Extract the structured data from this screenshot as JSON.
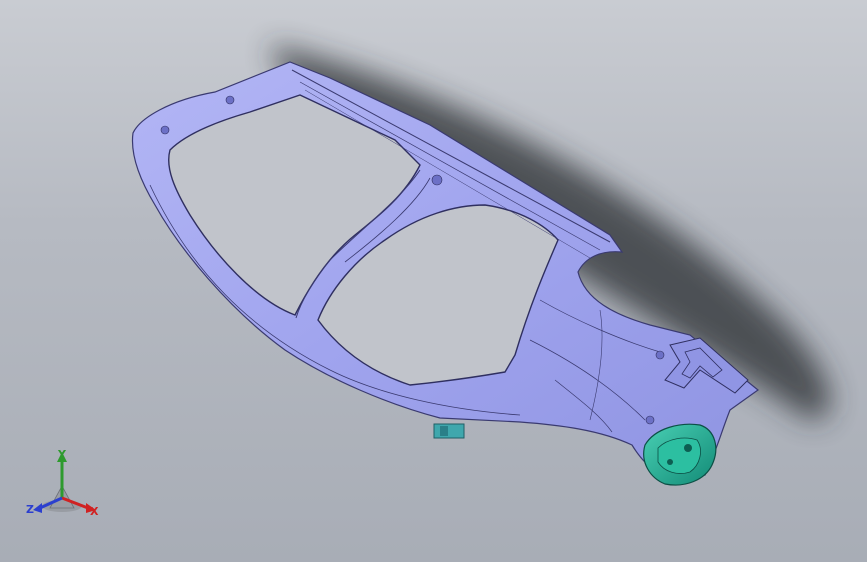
{
  "viewport": {
    "background_top": "#c9ccd2",
    "background_bottom": "#a8adb6"
  },
  "model": {
    "body_color": "#a3a7f0",
    "edge_color": "#3a3a70",
    "bracket_color": "#3fa7ad",
    "taillight_color": "#1ea38a"
  },
  "triad": {
    "y_label": "Y",
    "z_label": "Z",
    "x_label": "X",
    "y_color": "#2e9a2e",
    "z_color": "#2b3fcf",
    "x_color": "#d02222"
  }
}
